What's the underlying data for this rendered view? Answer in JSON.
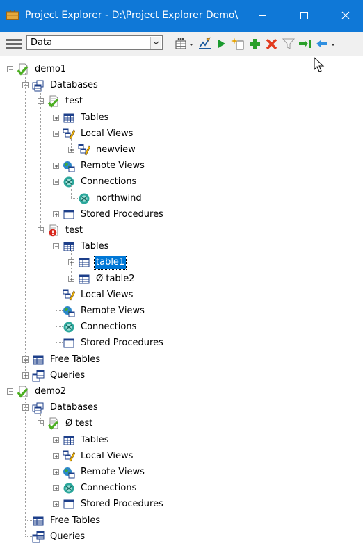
{
  "window": {
    "title": "Project Explorer - D:\\Project Explorer Demo\\",
    "accent": "#0f78d7"
  },
  "toolbar": {
    "combo_value": "Data",
    "buttons": [
      "grid-icon",
      "dropdown-icon",
      "edit-icon",
      "run-icon",
      "new-icon",
      "add-icon",
      "delete-icon",
      "filter-icon",
      "import-icon",
      "back-icon",
      "more-icon"
    ]
  },
  "tree": [
    {
      "label": "demo1",
      "icon": "project-green"
    },
    {
      "label": "Databases",
      "icon": "databases"
    },
    {
      "label": "test",
      "icon": "db-green"
    },
    {
      "label": "Tables",
      "icon": "tables"
    },
    {
      "label": "Local Views",
      "icon": "local-views"
    },
    {
      "label": "newview",
      "icon": "local-views"
    },
    {
      "label": "Remote Views",
      "icon": "remote-views"
    },
    {
      "label": "Connections",
      "icon": "connections"
    },
    {
      "label": "northwind",
      "icon": "connections"
    },
    {
      "label": "Stored Procedures",
      "icon": "stored-procs"
    },
    {
      "label": "test",
      "icon": "db-red"
    },
    {
      "label": "Tables",
      "icon": "tables"
    },
    {
      "label": "table1",
      "icon": "tables"
    },
    {
      "label": "Ø table2",
      "icon": "tables"
    },
    {
      "label": "Local Views",
      "icon": "local-views"
    },
    {
      "label": "Remote Views",
      "icon": "remote-views"
    },
    {
      "label": "Connections",
      "icon": "connections"
    },
    {
      "label": "Stored Procedures",
      "icon": "stored-procs"
    },
    {
      "label": "Free Tables",
      "icon": "tables"
    },
    {
      "label": "Queries",
      "icon": "queries"
    },
    {
      "label": "demo2",
      "icon": "project-green"
    },
    {
      "label": "Databases",
      "icon": "databases"
    },
    {
      "label": "Ø test",
      "icon": "db-green"
    },
    {
      "label": "Tables",
      "icon": "tables"
    },
    {
      "label": "Local Views",
      "icon": "local-views"
    },
    {
      "label": "Remote Views",
      "icon": "remote-views"
    },
    {
      "label": "Connections",
      "icon": "connections"
    },
    {
      "label": "Stored Procedures",
      "icon": "stored-procs"
    },
    {
      "label": "Free Tables",
      "icon": "tables"
    },
    {
      "label": "Queries",
      "icon": "queries"
    }
  ]
}
